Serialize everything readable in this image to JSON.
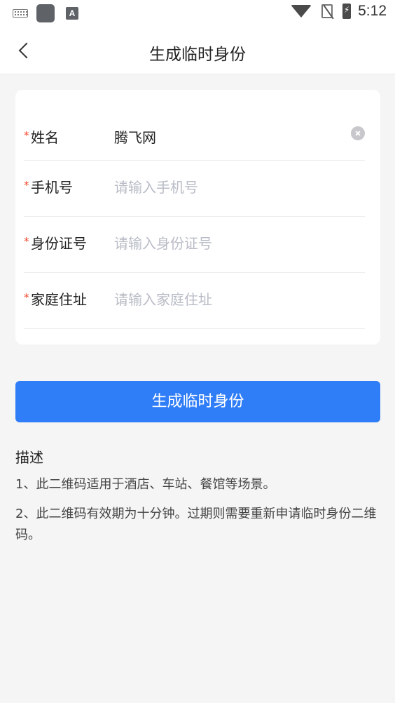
{
  "status_bar": {
    "time": "5:12",
    "icons": [
      "keyboard-icon",
      "app-square-icon",
      "text-a-icon",
      "wifi-icon",
      "no-sim-icon",
      "battery-charging-icon"
    ],
    "a_icon_text": "A"
  },
  "header": {
    "title": "生成临时身份",
    "back_icon": "chevron-left-icon"
  },
  "form": {
    "required_mark": "*",
    "fields": [
      {
        "label": "姓名",
        "value": "腾飞网",
        "placeholder": ""
      },
      {
        "label": "手机号",
        "value": "",
        "placeholder": "请输入手机号"
      },
      {
        "label": "身份证号",
        "value": "",
        "placeholder": "请输入身份证号"
      },
      {
        "label": "家庭住址",
        "value": "",
        "placeholder": "请输入家庭住址"
      }
    ],
    "clear_icon": "clear-circle-icon"
  },
  "actions": {
    "submit_label": "生成临时身份"
  },
  "description": {
    "title": "描述",
    "lines": [
      "1、此二维码适用于酒店、车站、餐馆等场景。",
      "2、此二维码有效期为十分钟。过期则需要重新申请临时身份二维码。"
    ]
  },
  "colors": {
    "primary": "#2f7df7",
    "required": "#f5472b",
    "placeholder": "#b9bcc6",
    "background": "#f5f5f5"
  }
}
